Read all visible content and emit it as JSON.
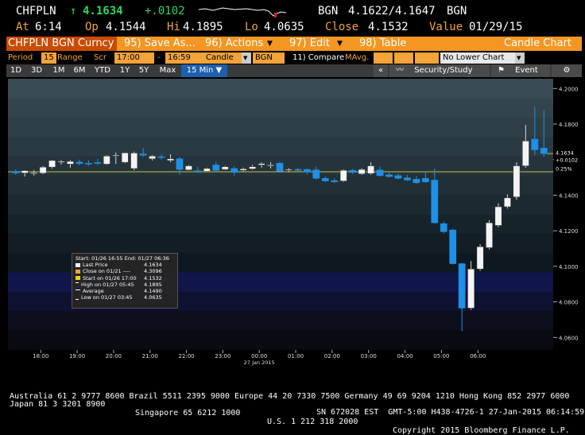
{
  "quote": {
    "ticker": "CHFPLN",
    "arrow": "↑",
    "last": "4.1634",
    "change": "+.0102",
    "source": "BGN",
    "bid_ask": "4.1622/4.1647",
    "source2": "BGN",
    "at_label": "At",
    "at": "6:14",
    "op_label": "Op",
    "op": "4.1544",
    "hi_label": "Hi",
    "hi": "4.1895",
    "lo_label": "Lo",
    "lo": "4.0635",
    "close_label": "Close",
    "close": "4.1532",
    "value_label": "Value",
    "value_date": "01/29/15"
  },
  "toolbar": {
    "security": "CHFPLN BGN Curncy",
    "save": "95) Save As...",
    "actions": "96) Actions",
    "edit": "97) Edit",
    "table": "98) Table",
    "chart_title": "Candle Chart"
  },
  "settings": {
    "period_label": "Period",
    "period_value": "15",
    "range_label": "Range",
    "scr_label": "Scr",
    "start_time": "17:00",
    "dash": "-",
    "end_time": "16:59",
    "chart_type": "Candle",
    "source": "BGN",
    "compare": "11) Compare",
    "mavg": "MAvg.",
    "lower": "No Lower Chart"
  },
  "ranges": {
    "items": [
      "1D",
      "3D",
      "1M",
      "6M",
      "YTD",
      "1Y",
      "5Y",
      "Max"
    ],
    "interval": "15 Min ▼",
    "collapse": "«",
    "security_study": "Security/Study",
    "event": "Event"
  },
  "legend": {
    "header": "Start: 01/26 16:55 End: 01/27 06:36",
    "rows": [
      {
        "label": "Last Price",
        "value": "4.1634",
        "color": "#ffffff"
      },
      {
        "label": "Close on 01/21 ----",
        "value": "4.3096",
        "color": "#f2a33a"
      },
      {
        "label": "Start on 01/26 17:00",
        "value": "4.1532",
        "color": "#f5d100"
      },
      {
        "label": "High on 01/27 05:45",
        "value": "4.1895",
        "color": "#ffffff"
      },
      {
        "label": "Average",
        "value": "4.1490",
        "color": "#ffffff"
      },
      {
        "label": "Low on 01/27 03:45",
        "value": "4.0635",
        "color": "#ffffff"
      }
    ]
  },
  "price_tags": {
    "last": "4.1634",
    "change": "+0.0102",
    "pct": "0.25%"
  },
  "chart_data": {
    "type": "candlestick",
    "x_labels": [
      "18:00",
      "19:00",
      "20:00",
      "21:00",
      "22:00",
      "23:00",
      "00:00",
      "01:00",
      "02:00",
      "03:00",
      "04:00",
      "05:00",
      "06:00"
    ],
    "date_label": "27 Jan 2015",
    "y_ticks": [
      "4.2000",
      "4.1800",
      "4.1600",
      "4.1400",
      "4.1200",
      "4.1000",
      "4.0800",
      "4.0600"
    ],
    "ylim": [
      4.053,
      4.2055
    ],
    "reference_line": 4.1532,
    "last_price": 4.1634,
    "colors": {
      "up": "#ffffff",
      "down": "#1e90e8",
      "reference": "#c9bf3a"
    },
    "candles": [
      {
        "o": 4.1534,
        "h": 4.1545,
        "l": 4.1515,
        "c": 4.1525
      },
      {
        "o": 4.1525,
        "h": 4.154,
        "l": 4.1505,
        "c": 4.1538
      },
      {
        "o": 4.1524,
        "h": 4.154,
        "l": 4.151,
        "c": 4.1526
      },
      {
        "o": 4.1524,
        "h": 4.1565,
        "l": 4.1518,
        "c": 4.1558
      },
      {
        "o": 4.1558,
        "h": 4.1598,
        "l": 4.155,
        "c": 4.1595
      },
      {
        "o": 4.1586,
        "h": 4.1598,
        "l": 4.1572,
        "c": 4.159
      },
      {
        "o": 4.1575,
        "h": 4.1598,
        "l": 4.1555,
        "c": 4.159
      },
      {
        "o": 4.1586,
        "h": 4.16,
        "l": 4.1568,
        "c": 4.1578
      },
      {
        "o": 4.158,
        "h": 4.1597,
        "l": 4.1565,
        "c": 4.1575
      },
      {
        "o": 4.1584,
        "h": 4.1605,
        "l": 4.157,
        "c": 4.158
      },
      {
        "o": 4.1575,
        "h": 4.1625,
        "l": 4.157,
        "c": 4.162
      },
      {
        "o": 4.162,
        "h": 4.164,
        "l": 4.1575,
        "c": 4.1625
      },
      {
        "o": 4.1585,
        "h": 4.164,
        "l": 4.158,
        "c": 4.1638
      },
      {
        "o": 4.155,
        "h": 4.1645,
        "l": 4.154,
        "c": 4.1637
      },
      {
        "o": 4.1632,
        "h": 4.1665,
        "l": 4.1615,
        "c": 4.1625
      },
      {
        "o": 4.1605,
        "h": 4.1625,
        "l": 4.1595,
        "c": 4.162
      },
      {
        "o": 4.1617,
        "h": 4.1632,
        "l": 4.16,
        "c": 4.1615
      },
      {
        "o": 4.1595,
        "h": 4.163,
        "l": 4.1585,
        "c": 4.1605
      },
      {
        "o": 4.1605,
        "h": 4.1615,
        "l": 4.1515,
        "c": 4.1545
      },
      {
        "o": 4.1542,
        "h": 4.157,
        "l": 4.154,
        "c": 4.1565
      },
      {
        "o": 4.1538,
        "h": 4.156,
        "l": 4.1525,
        "c": 4.1535
      },
      {
        "o": 4.1535,
        "h": 4.1555,
        "l": 4.153,
        "c": 4.155
      },
      {
        "o": 4.157,
        "h": 4.1588,
        "l": 4.1535,
        "c": 4.154
      },
      {
        "o": 4.1545,
        "h": 4.1565,
        "l": 4.1542,
        "c": 4.156
      },
      {
        "o": 4.155,
        "h": 4.1562,
        "l": 4.1508,
        "c": 4.1528
      },
      {
        "o": 4.154,
        "h": 4.1555,
        "l": 4.1535,
        "c": 4.1548
      },
      {
        "o": 4.1548,
        "h": 4.157,
        "l": 4.1543,
        "c": 4.156
      },
      {
        "o": 4.157,
        "h": 4.1585,
        "l": 4.1555,
        "c": 4.1578
      },
      {
        "o": 4.1565,
        "h": 4.1585,
        "l": 4.155,
        "c": 4.157
      },
      {
        "o": 4.158,
        "h": 4.1588,
        "l": 4.1525,
        "c": 4.1535
      },
      {
        "o": 4.154,
        "h": 4.1552,
        "l": 4.153,
        "c": 4.1545
      },
      {
        "o": 4.1545,
        "h": 4.1552,
        "l": 4.1536,
        "c": 4.1542
      },
      {
        "o": 4.1545,
        "h": 4.155,
        "l": 4.1518,
        "c": 4.153
      },
      {
        "o": 4.1542,
        "h": 4.156,
        "l": 4.1488,
        "c": 4.1495
      },
      {
        "o": 4.1495,
        "h": 4.1505,
        "l": 4.1475,
        "c": 4.148
      },
      {
        "o": 4.1482,
        "h": 4.1497,
        "l": 4.147,
        "c": 4.1475
      },
      {
        "o": 4.148,
        "h": 4.1545,
        "l": 4.1475,
        "c": 4.154
      },
      {
        "o": 4.154,
        "h": 4.1548,
        "l": 4.152,
        "c": 4.1528
      },
      {
        "o": 4.152,
        "h": 4.1552,
        "l": 4.1515,
        "c": 4.1545
      },
      {
        "o": 4.1522,
        "h": 4.1585,
        "l": 4.1515,
        "c": 4.1565
      },
      {
        "o": 4.1542,
        "h": 4.156,
        "l": 4.1505,
        "c": 4.151
      },
      {
        "o": 4.1515,
        "h": 4.1532,
        "l": 4.1498,
        "c": 4.1505
      },
      {
        "o": 4.151,
        "h": 4.1522,
        "l": 4.149,
        "c": 4.1495
      },
      {
        "o": 4.1498,
        "h": 4.1515,
        "l": 4.148,
        "c": 4.1485
      },
      {
        "o": 4.149,
        "h": 4.1508,
        "l": 4.1465,
        "c": 4.147
      },
      {
        "o": 4.1495,
        "h": 4.1535,
        "l": 4.147,
        "c": 4.1475
      },
      {
        "o": 4.1485,
        "h": 4.155,
        "l": 4.124,
        "c": 4.1245
      },
      {
        "o": 4.124,
        "h": 4.1252,
        "l": 4.1185,
        "c": 4.1195
      },
      {
        "o": 4.1205,
        "h": 4.121,
        "l": 4.101,
        "c": 4.1015
      },
      {
        "o": 4.1015,
        "h": 4.102,
        "l": 4.0635,
        "c": 4.0765
      },
      {
        "o": 4.0765,
        "h": 4.103,
        "l": 4.0755,
        "c": 4.0985
      },
      {
        "o": 4.0985,
        "h": 4.1125,
        "l": 4.0975,
        "c": 4.111
      },
      {
        "o": 4.1105,
        "h": 4.126,
        "l": 4.1095,
        "c": 4.1245
      },
      {
        "o": 4.123,
        "h": 4.1355,
        "l": 4.122,
        "c": 4.1335
      },
      {
        "o": 4.1335,
        "h": 4.1405,
        "l": 4.1325,
        "c": 4.1385
      },
      {
        "o": 4.139,
        "h": 4.1585,
        "l": 4.1375,
        "c": 4.1565
      },
      {
        "o": 4.1565,
        "h": 4.1795,
        "l": 4.1555,
        "c": 4.1705
      },
      {
        "o": 4.1715,
        "h": 4.1895,
        "l": 4.1625,
        "c": 4.1655
      },
      {
        "o": 4.1665,
        "h": 4.1878,
        "l": 4.1615,
        "c": 4.1634
      }
    ]
  },
  "footer": {
    "line1": "Australia 61 2 9777 8600 Brazil 5511 2395 9000 Europe 44 20 7330 7500 Germany 49 69 9204 1210 Hong Kong 852 2977 6000",
    "line2a": "Japan 81 3 3201 8900",
    "line2b": "Singapore 65 6212 1000",
    "line2c": "U.S. 1 212 318 2000",
    "line2d": "Copyright 2015 Bloomberg Finance L.P.",
    "line3": "SN 672028 EST  GMT-5:00 H438-4726-1 27-Jan-2015 06:14:59"
  }
}
